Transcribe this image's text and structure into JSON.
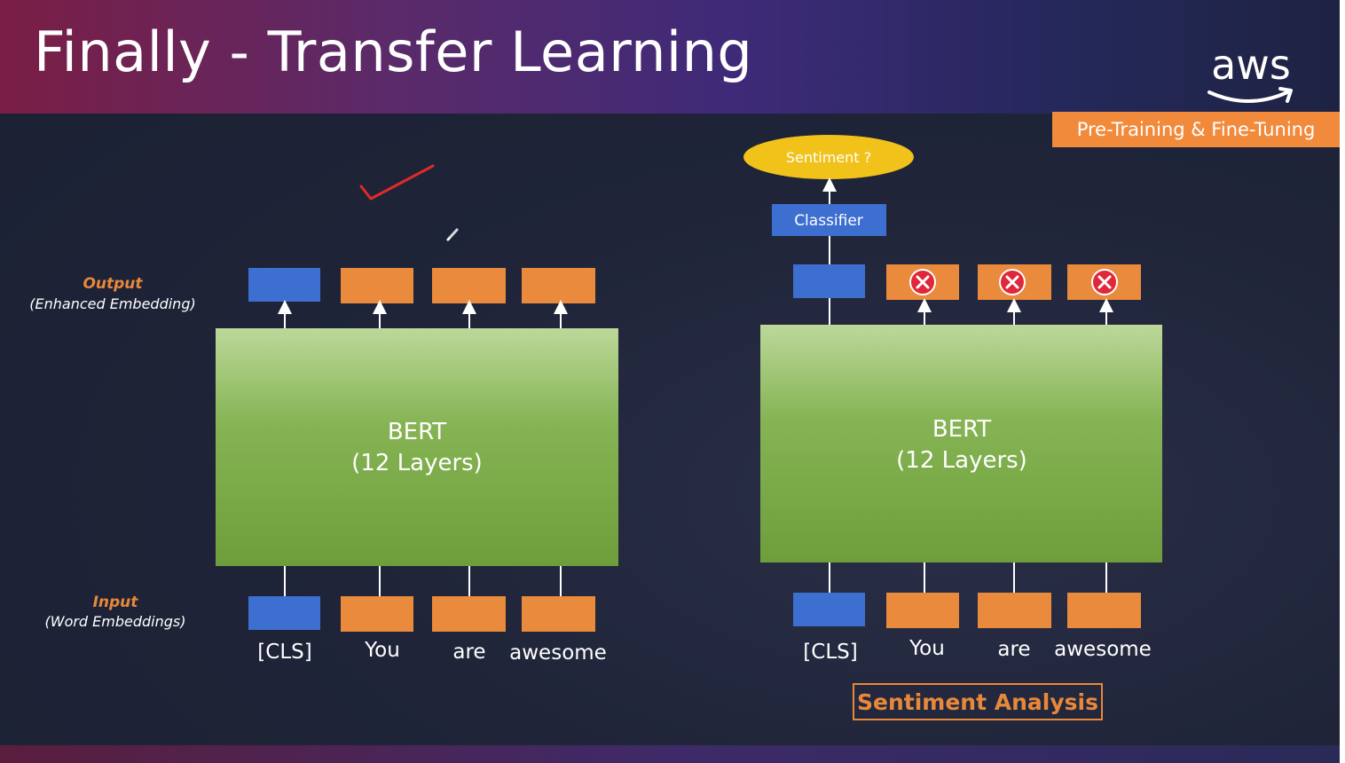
{
  "slide": {
    "title": "Finally - Transfer Learning",
    "logo_text": "aws",
    "tag": "Pre-Training & Fine-Tuning"
  },
  "left_diagram": {
    "output_label": "Output",
    "output_sublabel": "(Enhanced Embedding)",
    "input_label": "Input",
    "input_sublabel": "(Word Embeddings)",
    "bert_line1": "BERT",
    "bert_line2": "(12 Layers)",
    "tokens": [
      "[CLS]",
      "You",
      "are",
      "awesome"
    ]
  },
  "right_diagram": {
    "sentiment": "Sentiment ?",
    "classifier": "Classifier",
    "bert_line1": "BERT",
    "bert_line2": "(12 Layers)",
    "tokens": [
      "[CLS]",
      "You",
      "are",
      "awesome"
    ],
    "caption": "Sentiment Analysis"
  },
  "colors": {
    "blue_token": "#3d6fd0",
    "orange_token": "#e98a3c",
    "bert_green_top": "#bcd89a",
    "bert_green_bottom": "#6e9e3c",
    "sentiment_yellow": "#f0c21a",
    "reject_red": "#e0283a",
    "annotation_red": "#e02a2a"
  },
  "icons": {
    "reject": "x-circle-icon",
    "arrow": "arrow-up-icon",
    "annotation": "checkmark-icon",
    "cursor": "pen-cursor-icon"
  }
}
